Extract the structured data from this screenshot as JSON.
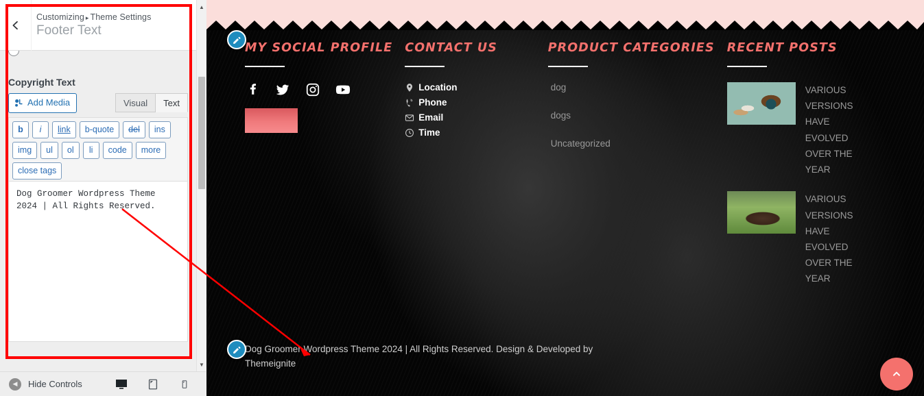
{
  "customizer": {
    "back_icon": "chevron-left-icon",
    "breadcrumb_root": "Customizing",
    "breadcrumb_sep": "▸",
    "breadcrumb_section": "Theme Settings",
    "panel_title": "Footer Text",
    "control_label": "Copyright Text",
    "add_media_label": "Add Media",
    "tabs": [
      {
        "label": "Visual",
        "active": false
      },
      {
        "label": "Text",
        "active": true
      }
    ],
    "quicktags": [
      "b",
      "i",
      "link",
      "b-quote",
      "del",
      "ins",
      "img",
      "ul",
      "ol",
      "li",
      "code",
      "more",
      "close tags"
    ],
    "textarea_value": "Dog Groomer Wordpress Theme 2024 | All Rights Reserved.",
    "footer": {
      "hide_controls_label": "Hide Controls",
      "devices": [
        {
          "name": "desktop",
          "active": true
        },
        {
          "name": "tablet",
          "active": false
        },
        {
          "name": "mobile",
          "active": false
        }
      ]
    }
  },
  "preview": {
    "columns": [
      {
        "title": "MY SOCIAL PROFILE",
        "type": "social",
        "socials": [
          "facebook-icon",
          "twitter-icon",
          "instagram-icon",
          "youtube-icon"
        ]
      },
      {
        "title": "CONTACT US",
        "type": "contact",
        "items": [
          {
            "icon": "map-pin-icon",
            "label": "Location"
          },
          {
            "icon": "phone-icon",
            "label": "Phone"
          },
          {
            "icon": "envelope-icon",
            "label": "Email"
          },
          {
            "icon": "clock-icon",
            "label": "Time"
          }
        ]
      },
      {
        "title": "PRODUCT CATEGORIES",
        "type": "categories",
        "items": [
          "dog",
          "dogs",
          "Uncategorized"
        ]
      },
      {
        "title": "RECENT POSTS",
        "type": "posts",
        "items": [
          {
            "title": "VARIOUS VERSIONS HAVE EVOLVED OVER THE YEAR",
            "thumb": "dog-food-bowl-photo"
          },
          {
            "title": "VARIOUS VERSIONS HAVE EVOLVED OVER THE YEAR",
            "thumb": "dog-on-grass-photo"
          }
        ]
      }
    ],
    "copyright": "Dog Groomer Wordpress Theme 2024 | All Rights Reserved. Design & Developed by Themeignite",
    "back_to_top_icon": "chevron-up-icon",
    "edit_pin_icon": "pencil-icon",
    "colors": {
      "accent": "#f4716d",
      "strip_pink": "#fbdedb",
      "footer_bg": "#040404",
      "muted_text": "#999999"
    }
  }
}
